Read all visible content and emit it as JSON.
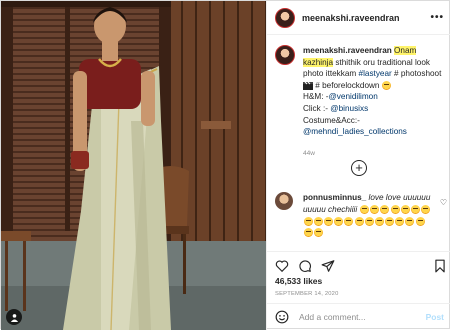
{
  "post": {
    "username": "meenakshi.raveendran",
    "caption": {
      "username": "meenakshi.raveendran",
      "highlight": "Onam kazhinja",
      "text1": " sthithik oru traditional look photo ittekkam ",
      "tag1": "#lastyear",
      "text2": " # photoshoot",
      "text3": " # beforelockdown",
      "hm_label": "H&M: -",
      "hm_mention": "@venidilimon",
      "click_label": "Click :-",
      "click_mention": "@binusixs",
      "costume_label": "Costume&Acc:-",
      "costume_mention": "@mehndi_ladies_collections",
      "time": "44w"
    },
    "comment": {
      "username": "ponnusminnus_",
      "text": " love love uuuuuuuuuuu chechiiii"
    },
    "likes": "46,533 likes",
    "date": "SEPTEMBER 14, 2020",
    "add_comment_placeholder": "Add a comment...",
    "post_button": "Post"
  },
  "icons": {
    "more": "more-dots-icon",
    "heart": "heart-icon",
    "comment": "comment-icon",
    "share": "share-icon",
    "save": "bookmark-icon",
    "emoji": "emoji-icon",
    "load_more": "plus-circle-icon",
    "tag": "user-tag-icon",
    "emoji_count": 21
  },
  "colors": {
    "highlight": "#fff46b",
    "mention": "#00376b",
    "post_button": "#b2dffc"
  }
}
